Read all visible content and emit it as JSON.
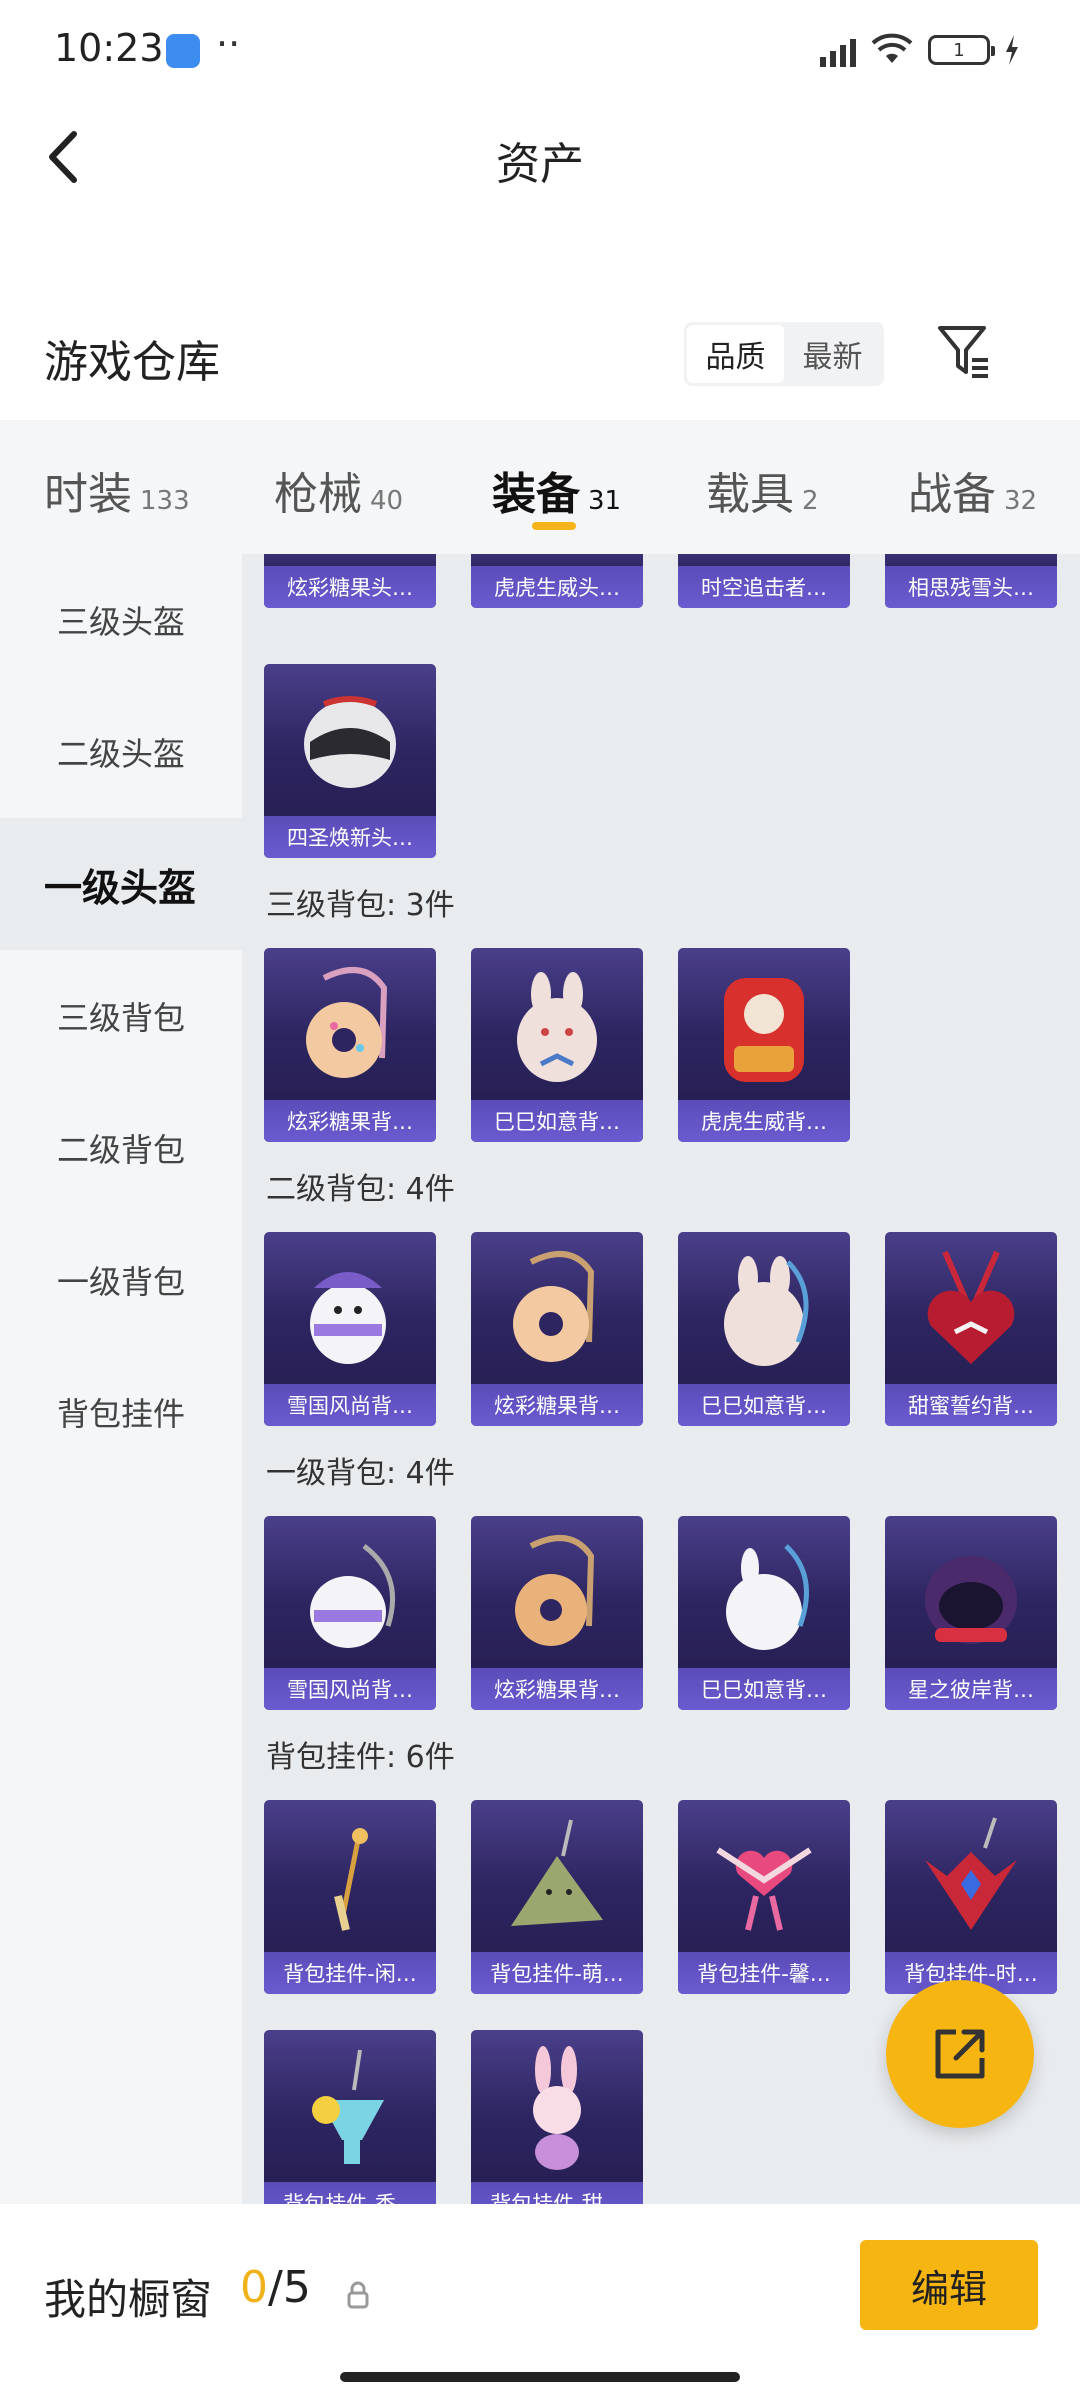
{
  "status": {
    "time": "10:23",
    "dots": "··",
    "battery": "1"
  },
  "nav": {
    "title": "资产"
  },
  "warehouse": {
    "title": "游戏仓库",
    "sort_options": [
      "品质",
      "最新"
    ],
    "active_sort": "品质"
  },
  "tabs": [
    {
      "label": "时装",
      "count": "133"
    },
    {
      "label": "枪械",
      "count": "40"
    },
    {
      "label": "装备",
      "count": "31"
    },
    {
      "label": "载具",
      "count": "2"
    },
    {
      "label": "战备",
      "count": "32"
    }
  ],
  "active_tab": "装备",
  "sidebar": {
    "items": [
      "三级头盔",
      "二级头盔",
      "一级头盔",
      "三级背包",
      "二级背包",
      "一级背包",
      "背包挂件"
    ],
    "active": "一级头盔"
  },
  "sections": {
    "top_partial": [
      "炫彩糖果头…",
      "虎虎生威头…",
      "时空追击者…",
      "相思残雪头…"
    ],
    "helmet_lv1": [
      "四圣焕新头…"
    ],
    "bag_lv3": {
      "title": "三级背包: 3件",
      "items": [
        "炫彩糖果背…",
        "巳巳如意背…",
        "虎虎生威背…"
      ]
    },
    "bag_lv2": {
      "title": "二级背包: 4件",
      "items": [
        "雪国风尚背…",
        "炫彩糖果背…",
        "巳巳如意背…",
        "甜蜜誓约背…"
      ]
    },
    "bag_lv1": {
      "title": "一级背包: 4件",
      "items": [
        "雪国风尚背…",
        "炫彩糖果背…",
        "巳巳如意背…",
        "星之彼岸背…"
      ]
    },
    "pendant": {
      "title": "背包挂件: 6件",
      "items": [
        "背包挂件-闲…",
        "背包挂件-萌…",
        "背包挂件-馨…",
        "背包挂件-时…",
        "背包挂件-香…",
        "背包挂件-甜…"
      ]
    }
  },
  "bottom": {
    "label": "我的橱窗",
    "current": "0",
    "separator": "/",
    "total": "5",
    "edit_label": "编辑"
  },
  "colors": {
    "accent": "#f7b512",
    "card_label": "#6a5bd0",
    "card_bg": "#2d2560"
  }
}
